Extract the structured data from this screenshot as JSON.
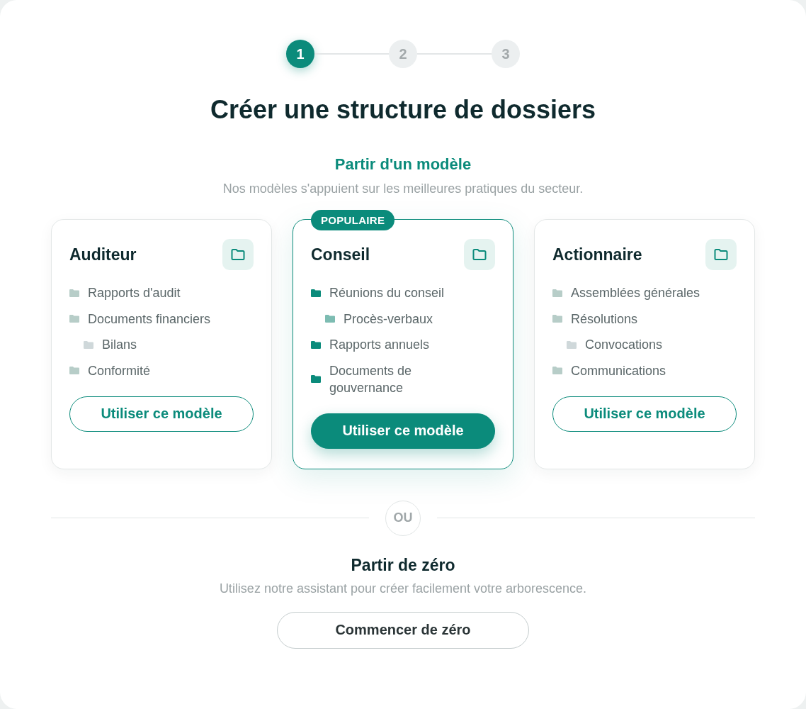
{
  "stepper": {
    "steps": [
      {
        "label": "1",
        "selected": true
      },
      {
        "label": "2",
        "selected": false
      },
      {
        "label": "3",
        "selected": false
      }
    ]
  },
  "title": "Créer une structure de dossiers",
  "templates": {
    "heading": "Partir d'un modèle",
    "subtitle": "Nos modèles s'appuient sur les meilleures pratiques du secteur.",
    "cards": [
      {
        "title": "Auditeur",
        "highlighted": false,
        "folders": [
          {
            "label": "Rapports d'audit"
          },
          {
            "label": "Documents financiers",
            "children": [
              {
                "label": "Bilans"
              }
            ]
          },
          {
            "label": "Conformité"
          }
        ],
        "button": "Utiliser ce modèle"
      },
      {
        "title": "Conseil",
        "badge": "POPULAIRE",
        "highlighted": true,
        "folders": [
          {
            "label": "Réunions du conseil",
            "children": [
              {
                "label": "Procès-verbaux"
              }
            ]
          },
          {
            "label": "Rapports annuels"
          },
          {
            "label": "Documents de gouvernance"
          }
        ],
        "button": "Utiliser ce modèle"
      },
      {
        "title": "Actionnaire",
        "highlighted": false,
        "folders": [
          {
            "label": "Assemblées générales"
          },
          {
            "label": "Résolutions",
            "children": [
              {
                "label": "Convocations"
              }
            ]
          },
          {
            "label": "Communications"
          }
        ],
        "button": "Utiliser ce modèle"
      }
    ]
  },
  "divider": {
    "label": "OU"
  },
  "scratch": {
    "heading": "Partir de zéro",
    "subtitle": "Utilisez notre assistant pour créer facilement votre arborescence.",
    "button": "Commencer de zéro"
  }
}
